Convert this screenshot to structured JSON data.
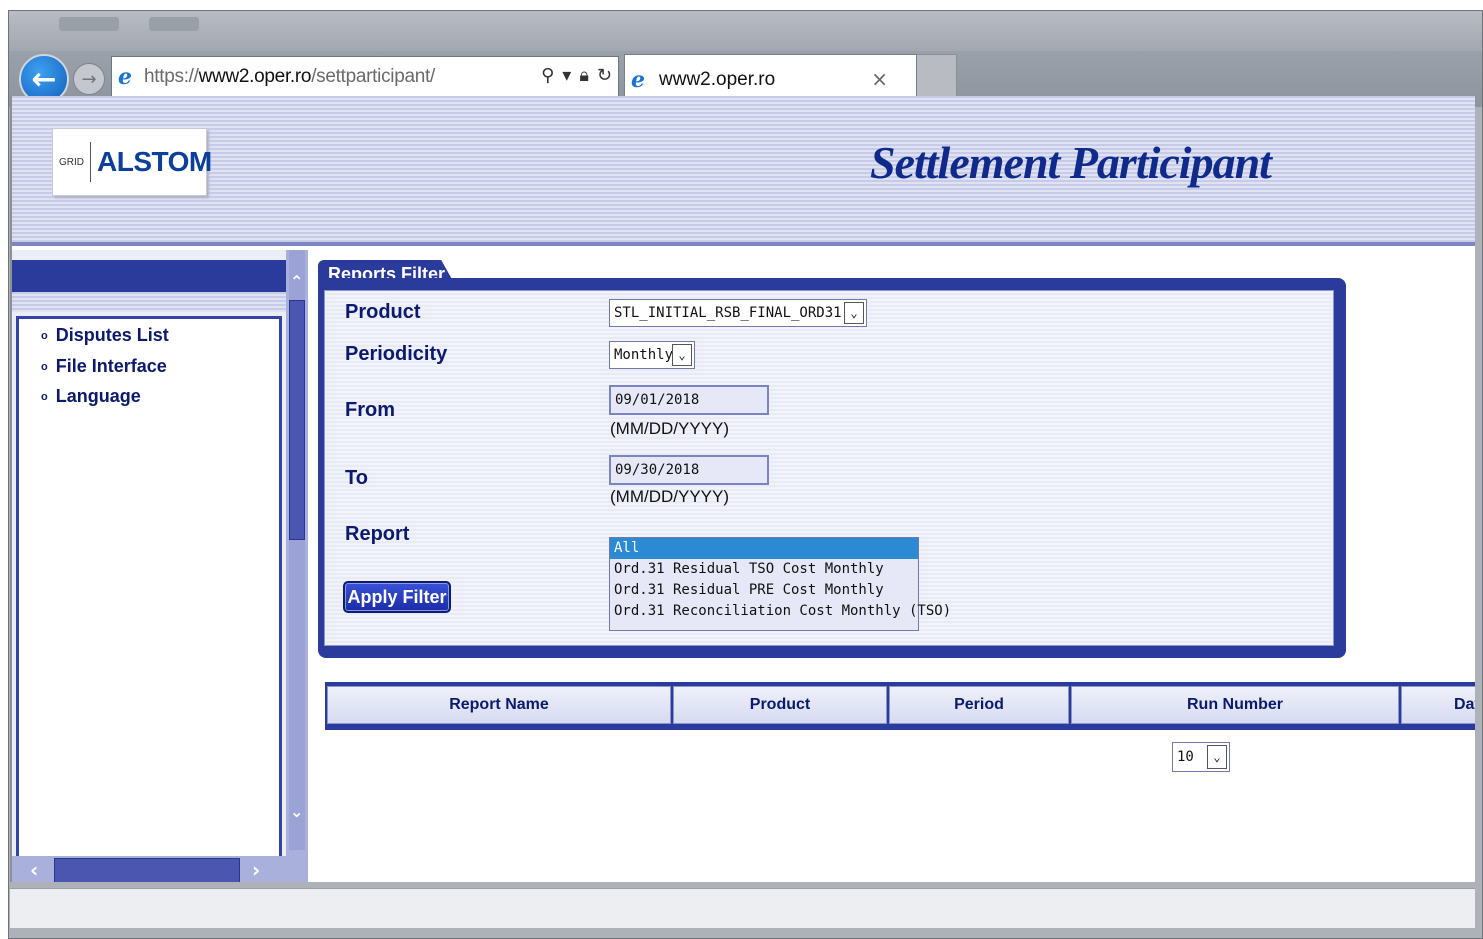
{
  "browser": {
    "url_prefix": "https://",
    "url_host": "www2.oper.ro",
    "url_path": "/settparticipant/",
    "tab_title": "www2.oper.ro",
    "tab_close": "×"
  },
  "header": {
    "logo_small": "GRID",
    "logo_brand": "ALSTOM",
    "page_title": "Settlement Participant"
  },
  "sidebar": {
    "items": [
      {
        "label": "Disputes List"
      },
      {
        "label": "File Interface"
      },
      {
        "label": "Language"
      }
    ]
  },
  "filter": {
    "tab_label": "Reports Filter",
    "product_label": "Product",
    "product_value": "STL_INITIAL_RSB_FINAL_ORD31",
    "periodicity_label": "Periodicity",
    "periodicity_value": "Monthly",
    "from_label": "From",
    "from_value": "09/01/2018",
    "from_hint": "(MM/DD/YYYY)",
    "to_label": "To",
    "to_value": "09/30/2018",
    "to_hint": "(MM/DD/YYYY)",
    "report_label": "Report",
    "report_options": [
      {
        "label": "All",
        "selected": true
      },
      {
        "label": "Ord.31 Residual TSO Cost Monthly",
        "selected": false
      },
      {
        "label": "Ord.31 Residual PRE Cost Monthly",
        "selected": false
      },
      {
        "label": "Ord.31 Reconciliation Cost Monthly (TSO)",
        "selected": false
      }
    ],
    "apply_label": "Apply Filter"
  },
  "grid": {
    "columns": [
      "Report Name",
      "Product",
      "Period",
      "Run Number",
      "Date"
    ]
  },
  "pager": {
    "page_size": "10"
  },
  "colors": {
    "accent": "#2a3b9c",
    "label_text": "#0b1a6e",
    "title_text": "#0f2a8a",
    "selected_option": "#2c8ad4"
  }
}
